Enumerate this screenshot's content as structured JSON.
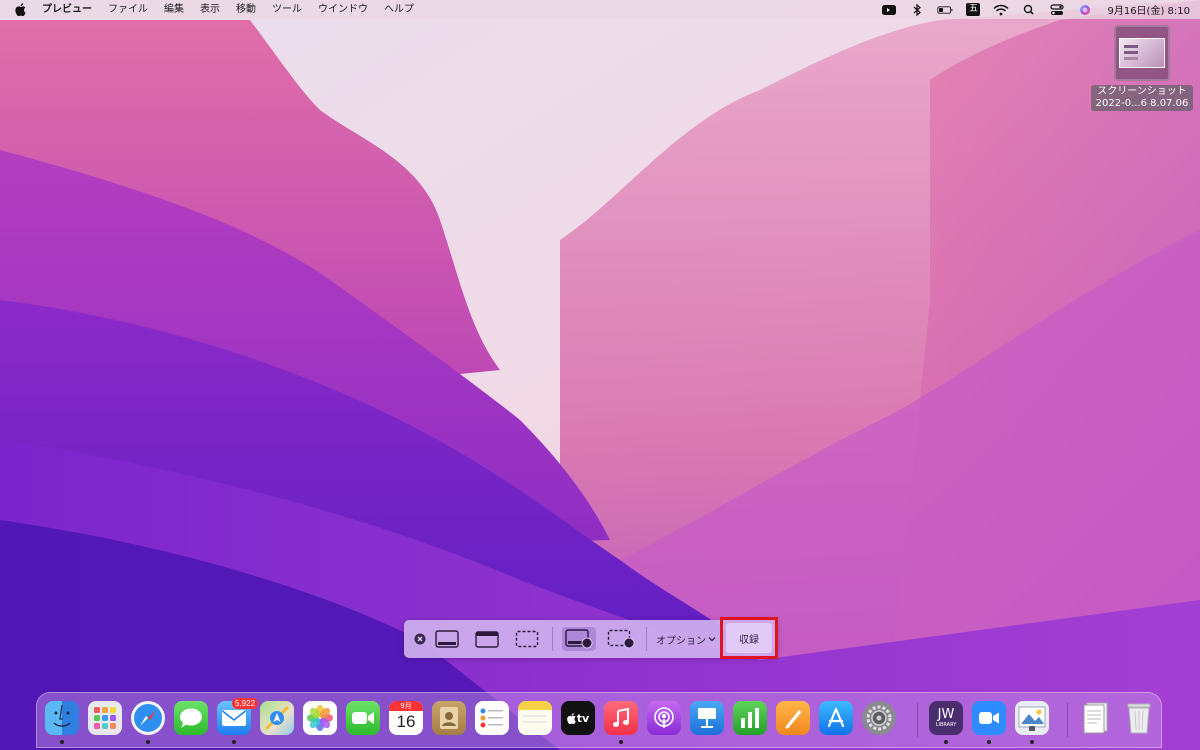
{
  "menubar": {
    "apple_icon": "apple-logo-icon",
    "app_name": "プレビュー",
    "menus": [
      "ファイル",
      "編集",
      "表示",
      "移動",
      "ツール",
      "ウインドウ",
      "ヘルプ"
    ],
    "status_icons": [
      "screen-recording-icon",
      "bluetooth-icon",
      "battery-icon",
      "input-method-icon",
      "wifi-icon",
      "search-icon",
      "control-center-icon",
      "siri-icon"
    ],
    "input_method_glyph": "五",
    "clock": "9月16日(金)  8:10"
  },
  "desktop": {
    "file_name_line1": "スクリーンショット",
    "file_name_line2": "2022-0...6 8.07.06"
  },
  "capture_toolbar": {
    "buttons": [
      "close-icon",
      "capture-entire-screen-icon",
      "capture-window-icon",
      "capture-selection-icon",
      "record-entire-screen-icon",
      "record-selection-icon"
    ],
    "selected": "record-entire-screen-icon",
    "options_label": "オプション",
    "record_label": "収録",
    "highlight_color": "#e0141e"
  },
  "dock": {
    "apps": [
      {
        "name": "Finder",
        "icon": "finder-icon",
        "running": true
      },
      {
        "name": "Launchpad",
        "icon": "launchpad-icon",
        "running": false
      },
      {
        "name": "Safari",
        "icon": "safari-icon",
        "running": true
      },
      {
        "name": "Messages",
        "icon": "messages-icon",
        "running": false
      },
      {
        "name": "Mail",
        "icon": "mail-icon",
        "running": true,
        "badge": "5,922"
      },
      {
        "name": "Maps",
        "icon": "maps-icon",
        "running": false
      },
      {
        "name": "Photos",
        "icon": "photos-icon",
        "running": false
      },
      {
        "name": "FaceTime",
        "icon": "facetime-icon",
        "running": false
      },
      {
        "name": "Calendar",
        "icon": "calendar-icon",
        "running": false,
        "month": "9月",
        "day": "16"
      },
      {
        "name": "Contacts",
        "icon": "contacts-icon",
        "running": false
      },
      {
        "name": "Reminders",
        "icon": "reminders-icon",
        "running": false
      },
      {
        "name": "Notes",
        "icon": "notes-icon",
        "running": false
      },
      {
        "name": "TV",
        "icon": "apple-tv-icon",
        "running": false,
        "label": "tv"
      },
      {
        "name": "Music",
        "icon": "music-icon",
        "running": true
      },
      {
        "name": "Podcasts",
        "icon": "podcasts-icon",
        "running": false
      },
      {
        "name": "Keynote",
        "icon": "keynote-icon",
        "running": false
      },
      {
        "name": "Numbers",
        "icon": "numbers-icon",
        "running": false
      },
      {
        "name": "Pages",
        "icon": "pages-icon",
        "running": false
      },
      {
        "name": "App Store",
        "icon": "app-store-icon",
        "running": false
      },
      {
        "name": "System Preferences",
        "icon": "system-preferences-icon",
        "running": false
      },
      {
        "name": "JW Library",
        "icon": "jw-library-icon",
        "running": true,
        "label": "JW",
        "sublabel": "LIBRARY"
      },
      {
        "name": "Zoom",
        "icon": "zoom-icon",
        "running": true
      },
      {
        "name": "Preview",
        "icon": "preview-icon",
        "running": true
      },
      {
        "name": "Screenshots Folder",
        "icon": "document-stack-icon",
        "running": false
      },
      {
        "name": "Trash",
        "icon": "trash-icon",
        "running": false
      }
    ]
  }
}
